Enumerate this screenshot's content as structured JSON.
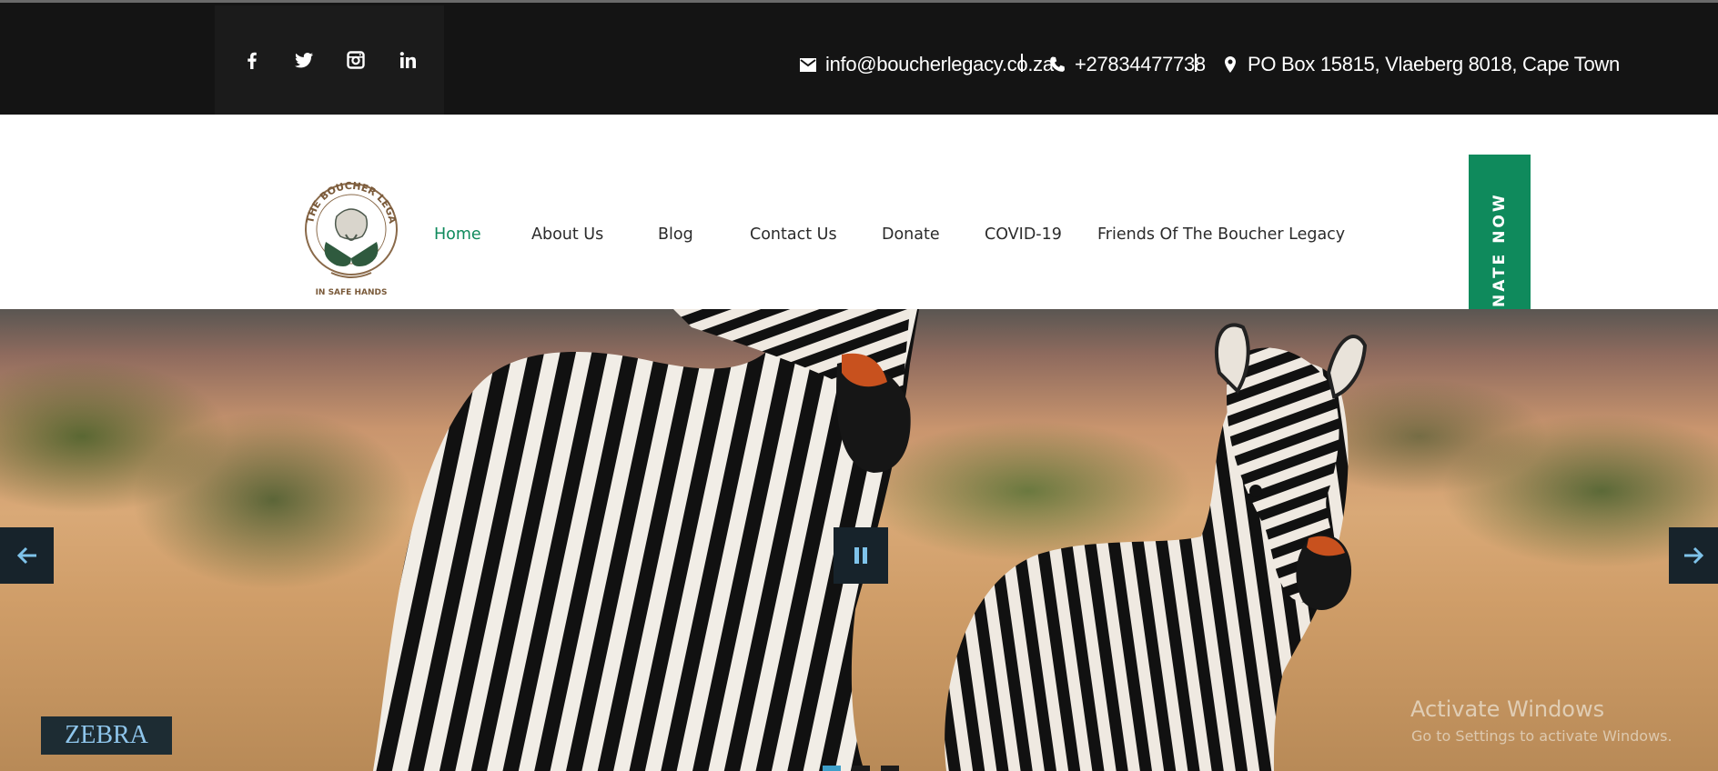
{
  "topbar": {
    "social": [
      {
        "icon": "facebook-icon",
        "label": "facebook"
      },
      {
        "icon": "twitter-icon",
        "label": "twitter"
      },
      {
        "icon": "instagram-icon",
        "label": "instagram"
      },
      {
        "icon": "linkedin-icon",
        "label": "linkedin"
      }
    ],
    "email": "info@boucherlegacy.co.za",
    "phone": "+27834477738",
    "address": "PO Box 15815, Vlaeberg 8018, Cape Town"
  },
  "logo": {
    "arc_text": "THE BOUCHER LEGACY",
    "tagline": "IN SAFE HANDS"
  },
  "nav": {
    "items": [
      "Home",
      "About Us",
      "Blog",
      "Contact Us",
      "Donate",
      "COVID-19",
      "Friends Of The Boucher Legacy"
    ],
    "active": "Home",
    "donate_tab": "NATE NOW"
  },
  "slider": {
    "caption": "ZEBRA",
    "dots": 3,
    "active_dot": 1
  },
  "watermark": {
    "line1": "Activate Windows",
    "line2": "Go to Settings to activate Windows."
  },
  "colors": {
    "topbar_bg": "#141414",
    "accent_green": "#0f8a5c",
    "caption_bg": "#1d2c33",
    "caption_text": "#8fc6ec",
    "active_dot": "#3e9fc9"
  }
}
